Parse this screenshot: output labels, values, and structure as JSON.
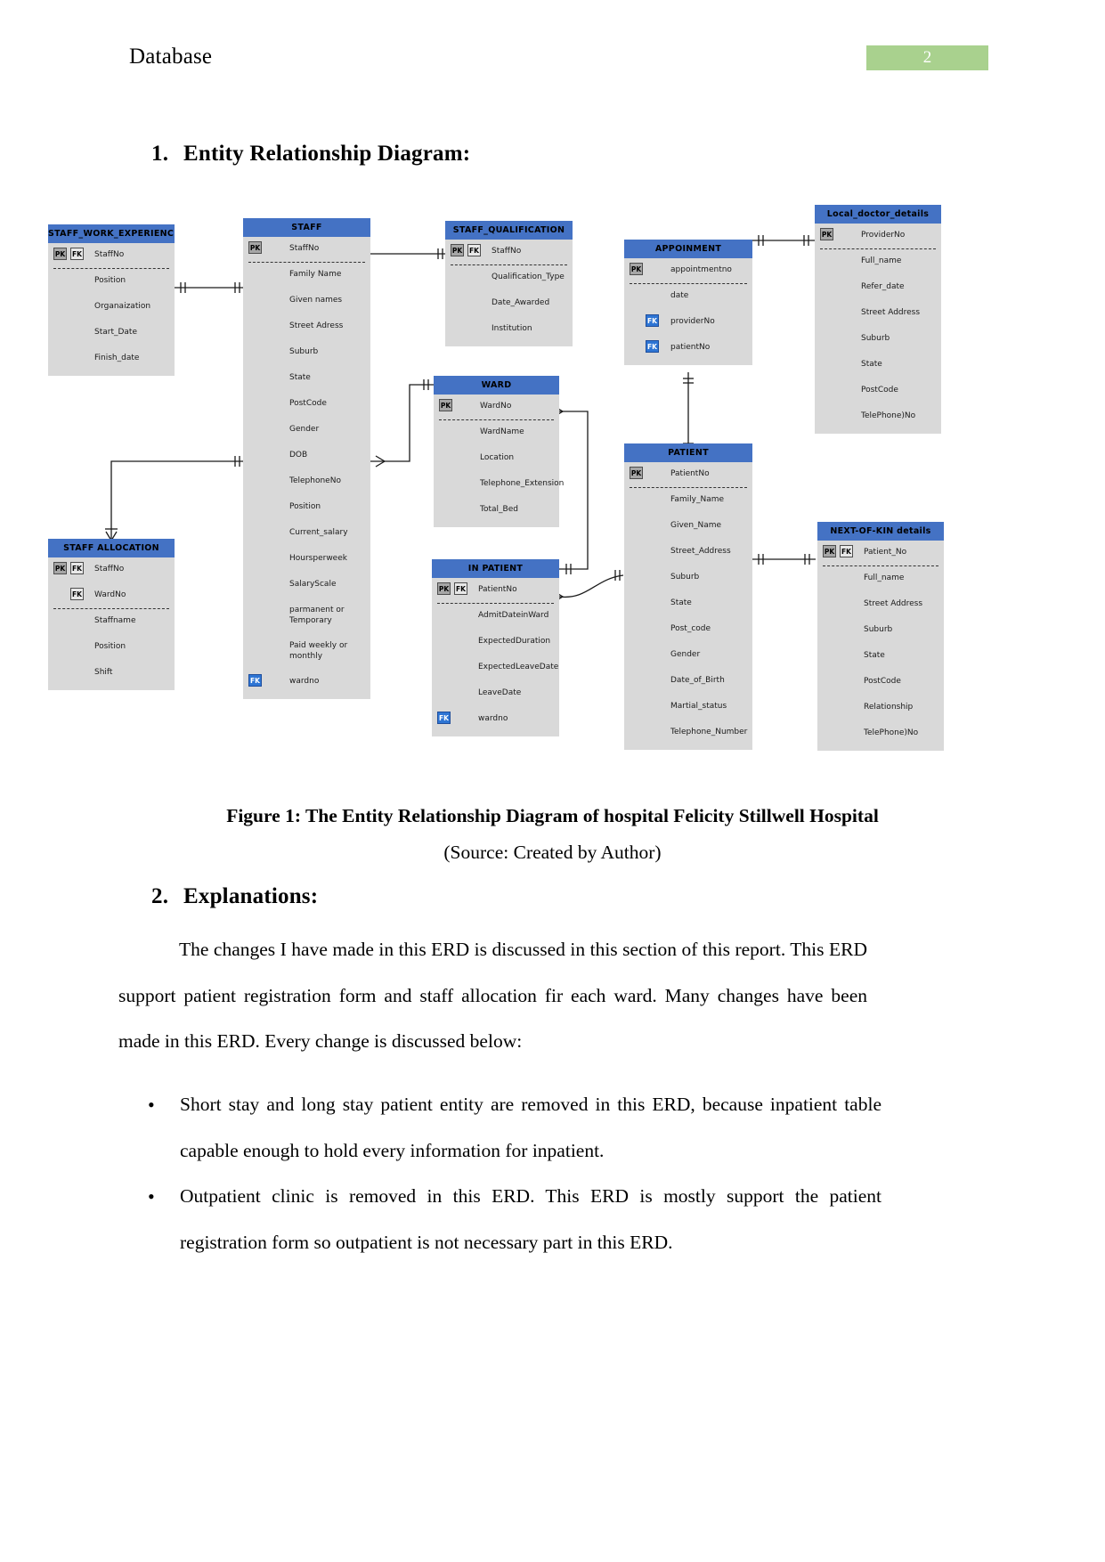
{
  "header": {
    "title": "Database",
    "page_number": "2"
  },
  "headings": {
    "s1_num": "1.",
    "s1_text": "Entity Relationship Diagram:",
    "s2_num": "2.",
    "s2_text": "Explanations:"
  },
  "figure": {
    "caption": "Figure 1: The Entity Relationship Diagram of hospital Felicity Stillwell Hospital",
    "source": "(Source: Created by Author)"
  },
  "body": {
    "para1": "The changes I have made in this ERD is discussed in this section of this report. This ERD support patient registration form and staff allocation fir each ward. Many changes have been made in this ERD. Every change is discussed below:",
    "bullet1": "Short stay and long stay patient entity are removed in this ERD, because inpatient table capable enough to hold every information for inpatient.",
    "bullet2": "Outpatient clinic is removed in this ERD. This ERD is mostly support the patient registration form so outpatient is not necessary part in this ERD."
  },
  "colors": {
    "entity_header": "#4472c4",
    "entity_body": "#d9d9d9",
    "pk_badge": "#a6a6a6",
    "fk_badge": "#e8e8e8",
    "fk_badge_blue": "#2e75d4",
    "page_badge": "#a9d18e"
  },
  "erd": {
    "entities": [
      {
        "name": "STAFF_WORK_EXPERIENCE",
        "attributes": [
          {
            "keys": [
              "PK",
              "FK"
            ],
            "name": "StaffNo",
            "separator": true
          },
          {
            "keys": [],
            "name": "Position"
          },
          {
            "keys": [],
            "name": "Organaization"
          },
          {
            "keys": [],
            "name": "Start_Date"
          },
          {
            "keys": [],
            "name": "Finish_date"
          }
        ]
      },
      {
        "name": "STAFF",
        "attributes": [
          {
            "keys": [
              "PK"
            ],
            "name": "StaffNo",
            "separator": true
          },
          {
            "keys": [],
            "name": "Family Name"
          },
          {
            "keys": [],
            "name": "Given names"
          },
          {
            "keys": [],
            "name": "Street Adress"
          },
          {
            "keys": [],
            "name": "Suburb"
          },
          {
            "keys": [],
            "name": "State"
          },
          {
            "keys": [],
            "name": "PostCode"
          },
          {
            "keys": [],
            "name": "Gender"
          },
          {
            "keys": [],
            "name": "DOB"
          },
          {
            "keys": [],
            "name": "TelephoneNo"
          },
          {
            "keys": [],
            "name": "Position"
          },
          {
            "keys": [],
            "name": "Current_salary"
          },
          {
            "keys": [],
            "name": "Hoursperweek"
          },
          {
            "keys": [],
            "name": "SalaryScale"
          },
          {
            "keys": [],
            "name": "parmanent or Temporary"
          },
          {
            "keys": [],
            "name": "Paid weekly or monthly"
          },
          {
            "keys": [
              "FK-BLUE"
            ],
            "name": "wardno"
          }
        ]
      },
      {
        "name": "STAFF ALLOCATION",
        "attributes": [
          {
            "keys": [
              "PK",
              "FK"
            ],
            "name": "StaffNo"
          },
          {
            "keys": [
              "FK"
            ],
            "name": "WardNo",
            "separator": true
          },
          {
            "keys": [],
            "name": "Staffname"
          },
          {
            "keys": [],
            "name": "Position"
          },
          {
            "keys": [],
            "name": "Shift"
          }
        ]
      },
      {
        "name": "STAFF_QUALIFICATION",
        "attributes": [
          {
            "keys": [
              "PK",
              "FK"
            ],
            "name": "StaffNo",
            "separator": true
          },
          {
            "keys": [],
            "name": "Qualification_Type"
          },
          {
            "keys": [],
            "name": "Date_Awarded"
          },
          {
            "keys": [],
            "name": "Institution"
          }
        ]
      },
      {
        "name": "WARD",
        "attributes": [
          {
            "keys": [
              "PK"
            ],
            "name": "WardNo",
            "separator": true
          },
          {
            "keys": [],
            "name": "WardName"
          },
          {
            "keys": [],
            "name": "Location"
          },
          {
            "keys": [],
            "name": "Telephone_Extension"
          },
          {
            "keys": [],
            "name": "Total_Bed"
          }
        ]
      },
      {
        "name": "IN PATIENT",
        "attributes": [
          {
            "keys": [
              "PK",
              "FK"
            ],
            "name": "PatientNo",
            "separator": true
          },
          {
            "keys": [],
            "name": "AdmitDateinWard"
          },
          {
            "keys": [],
            "name": "ExpectedDuration"
          },
          {
            "keys": [],
            "name": "ExpectedLeaveDate"
          },
          {
            "keys": [],
            "name": "LeaveDate"
          },
          {
            "keys": [
              "FK-BLUE"
            ],
            "name": "wardno"
          }
        ]
      },
      {
        "name": "APPOINMENT",
        "attributes": [
          {
            "keys": [
              "PK"
            ],
            "name": "appointmentno",
            "separator": true
          },
          {
            "keys": [],
            "name": "date"
          },
          {
            "keys": [
              "FK-BLUE"
            ],
            "name": "providerNo"
          },
          {
            "keys": [
              "FK-BLUE"
            ],
            "name": "patientNo"
          }
        ]
      },
      {
        "name": "PATIENT",
        "attributes": [
          {
            "keys": [
              "PK"
            ],
            "name": "PatientNo",
            "separator": true
          },
          {
            "keys": [],
            "name": "Family_Name"
          },
          {
            "keys": [],
            "name": "Given_Name"
          },
          {
            "keys": [],
            "name": "Street_Address"
          },
          {
            "keys": [],
            "name": "Suburb"
          },
          {
            "keys": [],
            "name": "State"
          },
          {
            "keys": [],
            "name": "Post_code"
          },
          {
            "keys": [],
            "name": "Gender"
          },
          {
            "keys": [],
            "name": "Date_of_Birth"
          },
          {
            "keys": [],
            "name": "Martial_status"
          },
          {
            "keys": [],
            "name": "Telephone_Number"
          }
        ]
      },
      {
        "name": "Local_doctor_details",
        "attributes": [
          {
            "keys": [
              "PK"
            ],
            "name": "ProviderNo",
            "separator": true
          },
          {
            "keys": [],
            "name": "Full_name"
          },
          {
            "keys": [],
            "name": "Refer_date"
          },
          {
            "keys": [],
            "name": "Street Address"
          },
          {
            "keys": [],
            "name": "Suburb"
          },
          {
            "keys": [],
            "name": "State"
          },
          {
            "keys": [],
            "name": "PostCode"
          },
          {
            "keys": [],
            "name": "TelePhone)No"
          }
        ]
      },
      {
        "name": "NEXT-OF-KIN details",
        "attributes": [
          {
            "keys": [
              "PK",
              "FK"
            ],
            "name": "Patient_No",
            "separator": true
          },
          {
            "keys": [],
            "name": "Full_name"
          },
          {
            "keys": [],
            "name": "Street Address"
          },
          {
            "keys": [],
            "name": "Suburb"
          },
          {
            "keys": [],
            "name": "State"
          },
          {
            "keys": [],
            "name": "PostCode"
          },
          {
            "keys": [],
            "name": "Relationship"
          },
          {
            "keys": [],
            "name": "TelePhone)No"
          }
        ]
      }
    ]
  }
}
